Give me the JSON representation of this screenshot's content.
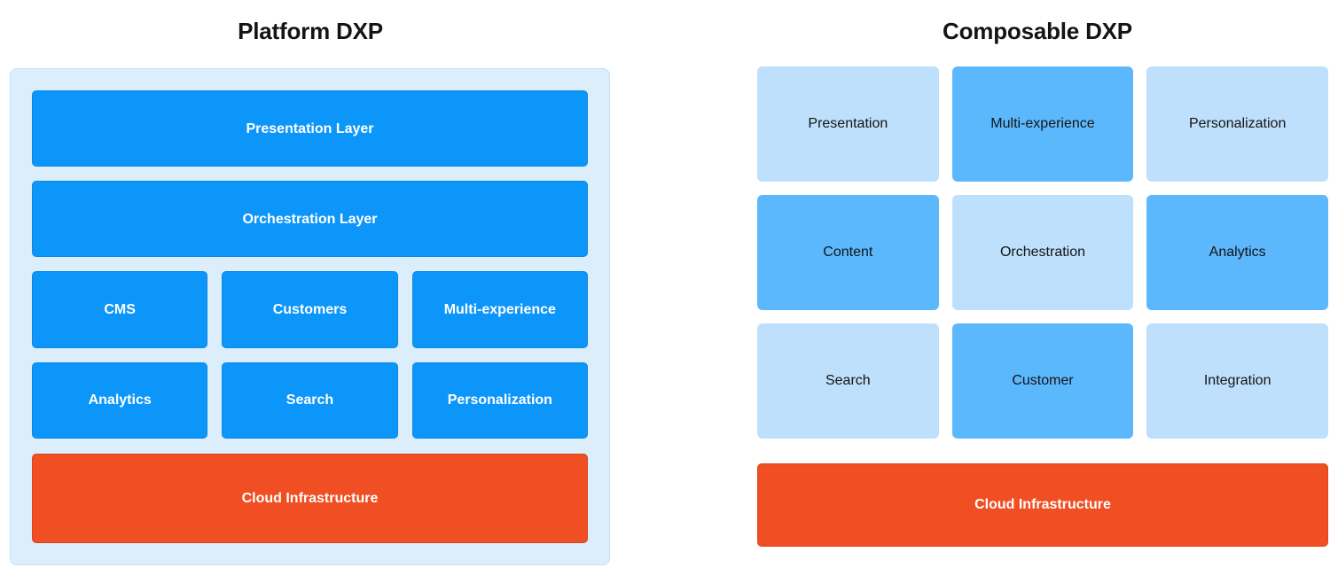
{
  "diagram": {
    "type": "comparison-architecture-diagram",
    "background_color": "#ffffff"
  },
  "platform": {
    "title": "Platform DXP",
    "panel_color": "#dcedfb",
    "panel_border_color": "#c3e0f7",
    "block_color": "#0d96fa",
    "infrastructure_color": "#f04e23",
    "layers": [
      {
        "label": "Presentation Layer",
        "style": "full-width-blue"
      },
      {
        "label": "Orchestration Layer",
        "style": "full-width-blue"
      }
    ],
    "modules": [
      {
        "label": "CMS"
      },
      {
        "label": "Customers"
      },
      {
        "label": "Multi-experience"
      },
      {
        "label": "Analytics"
      },
      {
        "label": "Search"
      },
      {
        "label": "Personalization"
      }
    ],
    "infrastructure": {
      "label": "Cloud Infrastructure"
    }
  },
  "composable": {
    "title": "Composable DXP",
    "light_color": "#bee0fc",
    "medium_color": "#5cb8fd",
    "infrastructure_color": "#f04e23",
    "cards": [
      {
        "label": "Presentation",
        "shade": "light"
      },
      {
        "label": "Multi-experience",
        "shade": "medium"
      },
      {
        "label": "Personalization",
        "shade": "light"
      },
      {
        "label": "Content",
        "shade": "medium"
      },
      {
        "label": "Orchestration",
        "shade": "light"
      },
      {
        "label": "Analytics",
        "shade": "medium"
      },
      {
        "label": "Search",
        "shade": "light"
      },
      {
        "label": "Customer",
        "shade": "medium"
      },
      {
        "label": "Integration",
        "shade": "light"
      }
    ],
    "infrastructure": {
      "label": "Cloud Infrastructure"
    }
  }
}
